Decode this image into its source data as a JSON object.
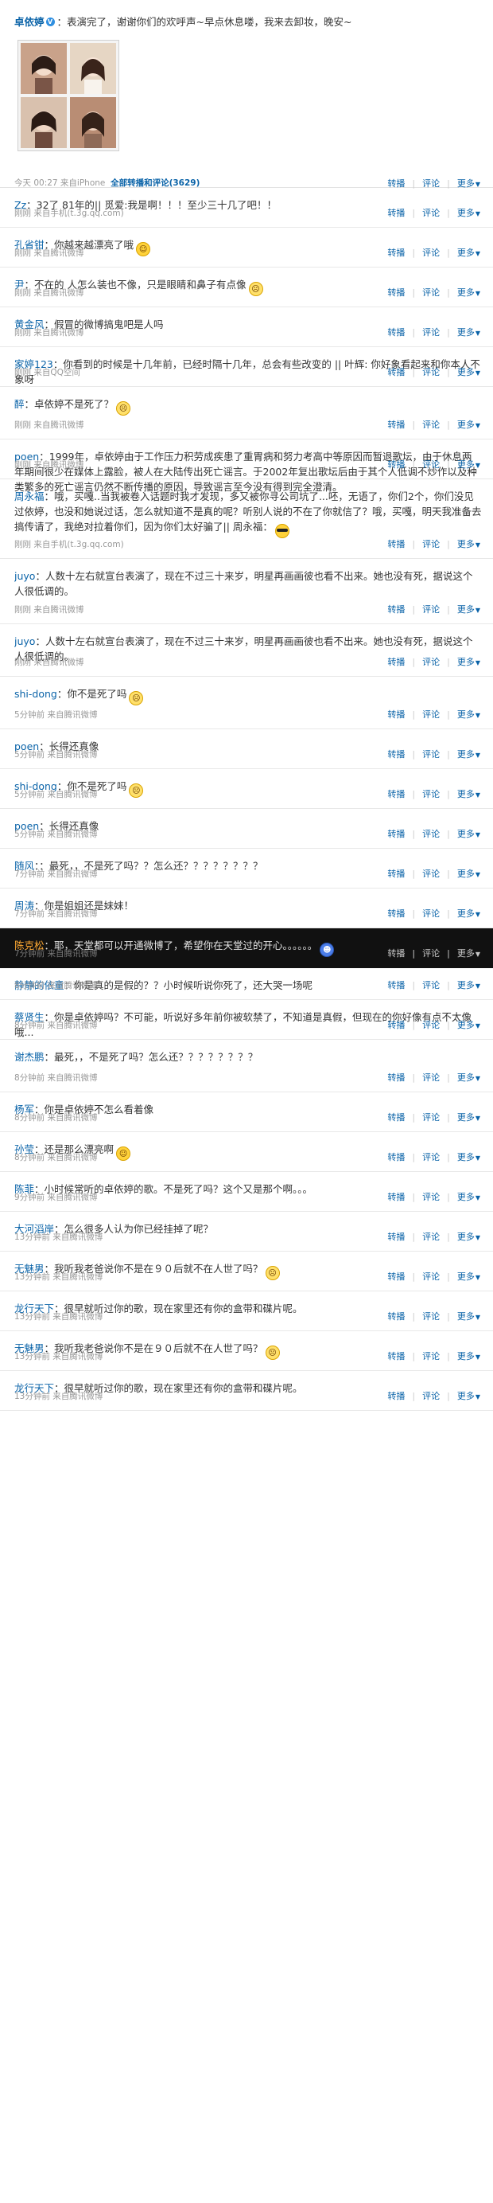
{
  "origin": {
    "author": "卓依婷",
    "verified_badge": "V",
    "text": "：表演完了，谢谢你们的欢呼声~早点休息喽，我来去卸妆，晚安~",
    "meta": "今天 00:27 来自iPhone",
    "view_all": "全部转播和评论(3629)",
    "thumbnail": "photo-collage"
  },
  "actions": {
    "repost": "转播",
    "comment": "评论",
    "more": "更多"
  },
  "replies": [
    {
      "name": "Zz",
      "text": "：32了 81年的|| 觅爱:我是啊！！！至少三十几了吧！！",
      "emo": "",
      "meta": "刚刚 来自手机(t.3g.qq.com)"
    },
    {
      "name": "孔省钳",
      "text": "：你越来越漂亮了哦",
      "emo": "smile",
      "meta": "刚刚 来自腾讯微博"
    },
    {
      "name": "尹",
      "text": "：不在的 人怎么装也不像，只是眼睛和鼻子有点像",
      "emo": "sad",
      "meta": "刚刚 来自腾讯微博"
    },
    {
      "name": "黄金风",
      "text": "：假冒的微博搞鬼吧是人吗",
      "emo": "",
      "meta": "刚刚 来自腾讯微博"
    },
    {
      "name": "家婷123",
      "text": "：你看到的时候是十几年前，已经时隔十几年，总会有些改变的 || 叶辉: 你好象看起来和你本人不象呀",
      "emo": "",
      "meta": "刚刚 来自QQ空间"
    },
    {
      "name": "醉",
      "text": "：卓依婷不是死了？",
      "emo": "sad",
      "meta": "刚刚 来自腾讯微博"
    },
    {
      "name": "poen",
      "text": "：1999年，卓依婷由于工作压力积劳成疾患了重胃病和努力考高中等原因而暂退歌坛，由于休息两年期间很少在媒体上露脸，被人在大陆传出死亡谣言。于2002年复出歌坛后由于其个人低调不炒作以及种类繁多的死亡谣言仍然不断传播的原因，导致谣言至今没有得到完全澄清。",
      "emo": "",
      "meta": "刚刚 来自腾讯微博"
    },
    {
      "name": "周永福",
      "text": "：哦，买嘎..当我被卷入话题时我才发现，多又被你寻公司坑了...呸，无语了，你们2个，你们没见过依婷，也没和她说过话，怎么就知道不是真的呢？听别人说的不在了你就信了？哦，买嘎，明天我准备去搞传请了，我绝对拉着你们，因为你们太好骗了|| 周永福：",
      "emo": "cool",
      "meta": "刚刚 来自手机(t.3g.qq.com)"
    },
    {
      "name": "juyo",
      "text": "：人数十左右就宣台表演了，现在不过三十来岁，明星再画画彼也看不出来。她也没有死，据说这个人很低调的。",
      "emo": "",
      "meta": "刚刚 来自腾讯微博"
    },
    {
      "name": "juyo",
      "text": "：人数十左右就宣台表演了，现在不过三十来岁，明星再画画彼也看不出来。她也没有死，据说这个人很低调的。",
      "emo": "",
      "meta": "刚刚 来自腾讯微博"
    },
    {
      "name": "shi-dong",
      "text": "：你不是死了吗",
      "emo": "sad",
      "meta": "5分钟前 来自腾讯微博"
    },
    {
      "name": "poen",
      "text": "：长得还真像",
      "emo": "",
      "meta": "5分钟前 来自腾讯微博"
    },
    {
      "name": "shi-dong",
      "text": "：你不是死了吗",
      "emo": "sad",
      "meta": "5分钟前 来自腾讯微博"
    },
    {
      "name": "poen",
      "text": "：长得还真像",
      "emo": "",
      "meta": "5分钟前 来自腾讯微博"
    },
    {
      "name": "随风",
      "text": "：：最死，，不是死了吗？？怎么还？？？？？？？？",
      "emo": "",
      "meta": "7分钟前 来自腾讯微博"
    },
    {
      "name": "周涛",
      "text": "：你是姐姐还是妹妹！",
      "emo": "",
      "meta": "7分钟前 来自腾讯微博"
    },
    {
      "name": "陈克松",
      "text": "：耶，天堂都可以开通微博了，希望你在天堂过的开心。。。。。。",
      "emo": "blue",
      "meta": "7分钟前 来自腾讯微博"
    },
    {
      "name": "静静的依童",
      "text": "：你是真的是假的？？小时候听说你死了，还大哭一场呢",
      "emo": "",
      "meta": "8分钟前 来自腾讯微博"
    },
    {
      "name": "蔡贤生",
      "text": "：你是卓依婷吗？不可能，听说好多年前你被软禁了，不知道是真假，但现在的你好像有点不太像哦...",
      "emo": "",
      "meta": "8分钟前 来自腾讯微博"
    },
    {
      "name": "谢杰鹏",
      "text": "：最死，，不是死了吗？怎么还？？？？？？？？",
      "emo": "",
      "meta": "8分钟前 来自腾讯微博"
    },
    {
      "name": "杨军",
      "text": "：你是卓依婷不怎么看着像",
      "emo": "",
      "meta": "8分钟前 来自腾讯微博"
    },
    {
      "name": "孙莹",
      "text": "：还是那么漂亮啊",
      "emo": "smile",
      "meta": "8分钟前 来自腾讯微博"
    },
    {
      "name": "陈菲",
      "text": "：小时候常听的卓依婷的歌。不是死了吗？这个又是那个啊。。。",
      "emo": "",
      "meta": "9分钟前 来自腾讯微博"
    },
    {
      "name": "大河滔岸",
      "text": "：怎么很多人认为你已经挂掉了呢？",
      "emo": "",
      "meta": "13分钟前 来自腾讯微博"
    },
    {
      "name": "无魅男",
      "text": "：我听我老爸说你不是在９０后就不在人世了吗？",
      "emo": "sad",
      "meta": "13分钟前 来自腾讯微博"
    },
    {
      "name": "龙行天下",
      "text": "：很早就听过你的歌，现在家里还有你的盒带和碟片呢。",
      "emo": "",
      "meta": "13分钟前 来自腾讯微博"
    },
    {
      "name": "无魅男",
      "text": "：我听我老爸说你不是在９０后就不在人世了吗？",
      "emo": "sad",
      "meta": "13分钟前 来自腾讯微博"
    },
    {
      "name": "龙行天下",
      "text": "：很早就听过你的歌，现在家里还有你的盒带和碟片呢。",
      "emo": "",
      "meta": "13分钟前 来自腾讯微博"
    }
  ]
}
